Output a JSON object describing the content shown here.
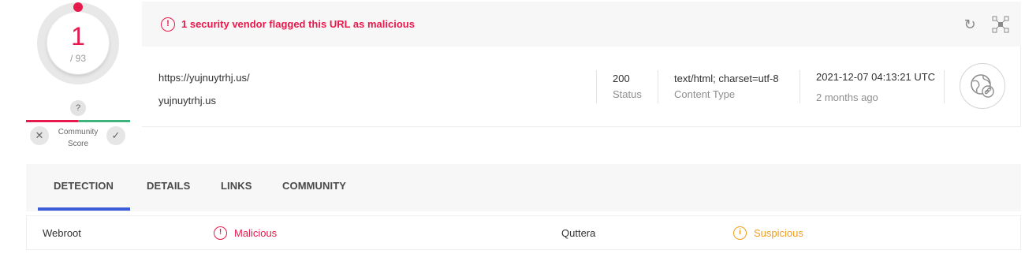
{
  "score": {
    "positives": "1",
    "total": "/ 93",
    "fraction": 0.0108,
    "color": "#e8194c"
  },
  "community": {
    "unknown_icon": "?",
    "label": "Community Score",
    "down_icon": "close-icon",
    "up_icon": "check-icon"
  },
  "alert": {
    "icon": "alert-circle-icon",
    "message": "1 security vendor flagged this URL as malicious",
    "color": "#e8194c"
  },
  "toolbar": {
    "reanalyze_icon": "reanalyze-icon",
    "graph_icon": "graph-icon"
  },
  "info": {
    "url": "https://yujnuytrhj.us/",
    "domain": "yujnuytrhj.us",
    "status_value": "200",
    "status_label": "Status",
    "content_type_value": "text/html; charset=utf-8",
    "content_type_label": "Content Type",
    "date_value": "2021-12-07 04:13:21 UTC",
    "date_label": "2 months ago",
    "globe_icon": "globe-link-icon"
  },
  "tabs": [
    {
      "label": "DETECTION",
      "active": true
    },
    {
      "label": "DETAILS",
      "active": false
    },
    {
      "label": "LINKS",
      "active": false
    },
    {
      "label": "COMMUNITY",
      "active": false
    }
  ],
  "accent": "#3c5bd6",
  "detections": [
    {
      "engine": "Webroot",
      "verdict": "Malicious",
      "verdict_icon": "alert-circle-icon",
      "color": "#e8194c"
    },
    {
      "engine": "Quttera",
      "verdict": "Suspicious",
      "verdict_icon": "info-circle-icon",
      "color": "#f19d1e"
    }
  ]
}
